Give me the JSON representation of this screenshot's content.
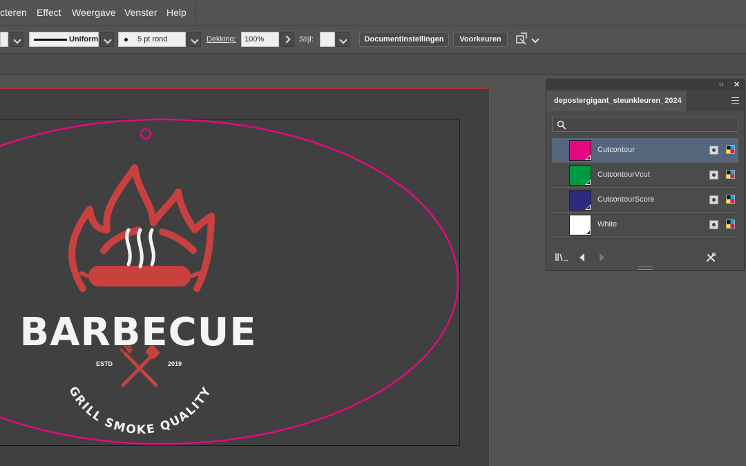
{
  "menubar": {
    "items": [
      "cteren",
      "Effect",
      "Weergave",
      "Venster",
      "Help"
    ]
  },
  "controlbar": {
    "stroke_profile": "Uniform",
    "brush": "5 pt rond",
    "opacity_label": "Dekking:",
    "opacity_value": "100%",
    "style_label": "Stijl:",
    "doc_settings_button": "Documentinstellingen",
    "preferences_button": "Voorkeuren"
  },
  "artwork": {
    "title": "BARBECUE",
    "estd": "ESTD",
    "year": "2019",
    "arc_text": "GRILL SMOKE QUALITY"
  },
  "swatches_panel": {
    "tab_title": "depostergigant_steunkleuren_2024",
    "search_placeholder": "",
    "swatches": [
      {
        "name": "Cutcontour",
        "color": "#e5097f",
        "selected": true
      },
      {
        "name": "CutcontourVcut",
        "color": "#009944",
        "selected": false
      },
      {
        "name": "CutcontourScore",
        "color": "#2e2a7d",
        "selected": false
      },
      {
        "name": "White",
        "color": "#ffffff",
        "selected": false
      }
    ]
  },
  "colors": {
    "cutcontour": "#e5097f",
    "logo_red": "#c8413f",
    "artboard_border": "#c7292b"
  }
}
